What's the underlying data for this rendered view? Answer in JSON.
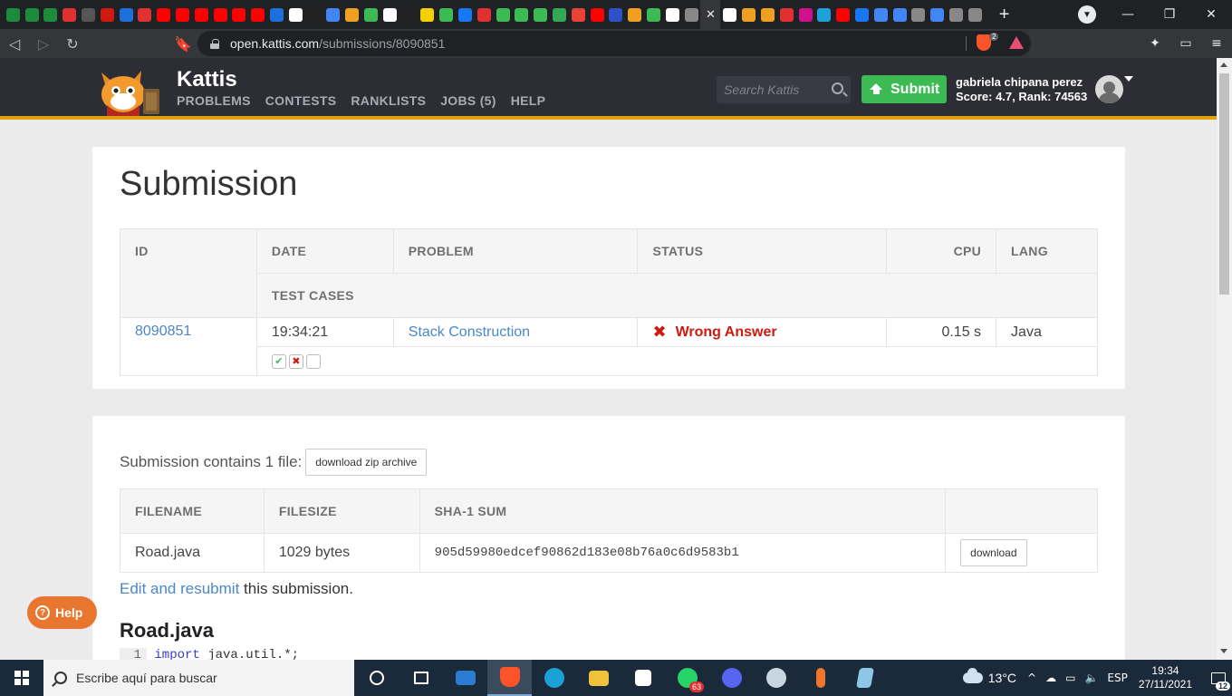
{
  "browser": {
    "favicons": [
      "#1c8c3c",
      "#1c8c3c",
      "#1c8c3c",
      "#e0302f",
      "#555",
      "#d0190f",
      "#1e6fd9",
      "#e0302f",
      "#ff0000",
      "#ff0000",
      "#ff0000",
      "#ff0000",
      "#ff0000",
      "#ff0000",
      "#1e6fd9",
      "#fff",
      "#222",
      "#4285f4",
      "#f0a020",
      "#3cba54",
      "#fff",
      "#222",
      "#f5d000",
      "#3cba54",
      "#1877f2",
      "#e0302f",
      "#3cba54",
      "#3cba54",
      "#3cba54",
      "#34a853",
      "#ea4335",
      "#ff0000",
      "#3050c8",
      "#f0a020",
      "#3cba54",
      "#fff",
      "#888",
      "#fff",
      "#f0a020",
      "#f0a020",
      "#e0302f",
      "#d0108c",
      "#1ea0d8",
      "#ff0000",
      "#1877f2",
      "#4285f4",
      "#4285f4",
      "#888",
      "#4285f4",
      "#888",
      "#888"
    ],
    "active_tab_icon": "close-icon",
    "new_tab_label": "+",
    "url_host": "open.kattis.com",
    "url_path": "/submissions/8090851",
    "brave_count": "2"
  },
  "site": {
    "brand": "Kattis",
    "nav": [
      "PROBLEMS",
      "CONTESTS",
      "RANKLISTS",
      "JOBS (5)",
      "HELP"
    ],
    "search_placeholder": "Search Kattis",
    "submit_label": "Submit",
    "user_name": "gabriela chipana perez",
    "user_score": "Score: 4.7, Rank: 74563",
    "accent": "#e3a00b",
    "submit_color": "#3cba54"
  },
  "submission": {
    "title": "Submission",
    "headers": {
      "id": "ID",
      "date": "DATE",
      "problem": "PROBLEM",
      "status": "STATUS",
      "cpu": "CPU",
      "lang": "LANG",
      "test_cases": "TEST CASES"
    },
    "row": {
      "id": "8090851",
      "date": "19:34:21",
      "problem": "Stack Construction",
      "status": "Wrong Answer",
      "cpu": "0.15 s",
      "lang": "Java"
    },
    "test_cases": [
      "accepted",
      "wrong",
      "not-run"
    ],
    "status_color": "#d0190f"
  },
  "files": {
    "intro": "Submission contains 1 file:",
    "zip_button": "download zip archive",
    "headers": {
      "filename": "FILENAME",
      "filesize": "FILESIZE",
      "sha1": "SHA-1 SUM"
    },
    "rows": [
      {
        "filename": "Road.java",
        "filesize": "1029 bytes",
        "sha1": "905d59980edcef90862d183e08b76a0c6d9583b1",
        "download": "download"
      }
    ],
    "resubmit_link": "Edit and resubmit",
    "resubmit_rest": " this submission.",
    "code_title": "Road.java",
    "code_first_line": {
      "number": "1",
      "keyword": "import",
      "rest": " java.util.*;"
    }
  },
  "help_button": "Help",
  "taskbar": {
    "search_placeholder": "Escribe aquí para buscar",
    "apps": [
      "cortana",
      "task-view",
      "mail",
      "brave",
      "edge",
      "explorer",
      "store",
      "whatsapp",
      "discord",
      "steam",
      "mic-app",
      "notepad"
    ],
    "whatsapp_badge": "63",
    "temperature": "13°C",
    "language": "ESP",
    "time": "19:34",
    "date": "27/11/2021",
    "notifications": "12"
  }
}
